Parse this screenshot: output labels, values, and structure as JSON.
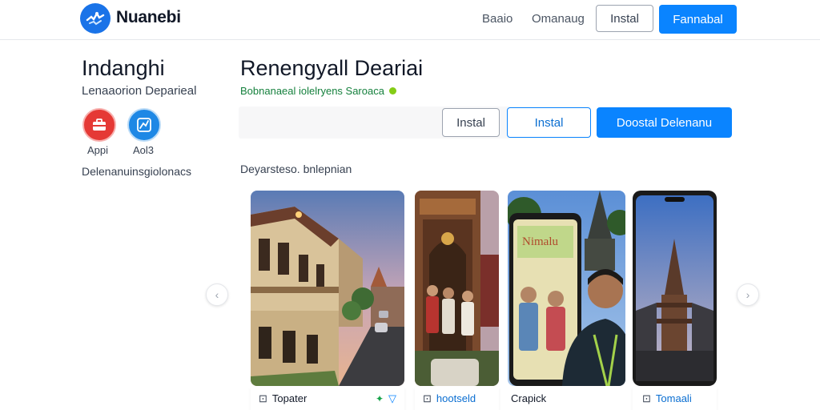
{
  "header": {
    "brand": "Nuanebi",
    "nav": [
      "Baaio",
      "Omanaug"
    ],
    "install_label": "Instal",
    "primary_label": "Fannabal"
  },
  "sidebar": {
    "title": "Indanghi",
    "subtitle": "Lenaaorion Deparieal",
    "icons": [
      {
        "label": "Appi",
        "icon": "briefcase-icon",
        "color": "#e53935"
      },
      {
        "label": "Aol3",
        "icon": "map-icon",
        "color": "#1e88e5"
      }
    ],
    "footer": "Delenanuinsgiolonacs"
  },
  "main": {
    "title": "Renengyall Deariai",
    "subtitle": "Bobnanaeal iolelryens Saroaca",
    "buttons": {
      "install_outline": "Instal",
      "install_accent": "Instal",
      "download": "Doostal Delenanu"
    },
    "description_label": "Deyarsteso. bnlepnian"
  },
  "carousel": {
    "items": [
      {
        "caption": "Topater",
        "icon": "image-icon",
        "accent": "#0a84ff"
      },
      {
        "caption": "hootseld",
        "icon": "image-icon"
      },
      {
        "caption": "Crapick"
      },
      {
        "caption": "Tomaali",
        "icon": "image-icon"
      }
    ],
    "poster_text": "Nimalu"
  },
  "colors": {
    "accent": "#0a84ff",
    "verified": "#84cc16"
  }
}
